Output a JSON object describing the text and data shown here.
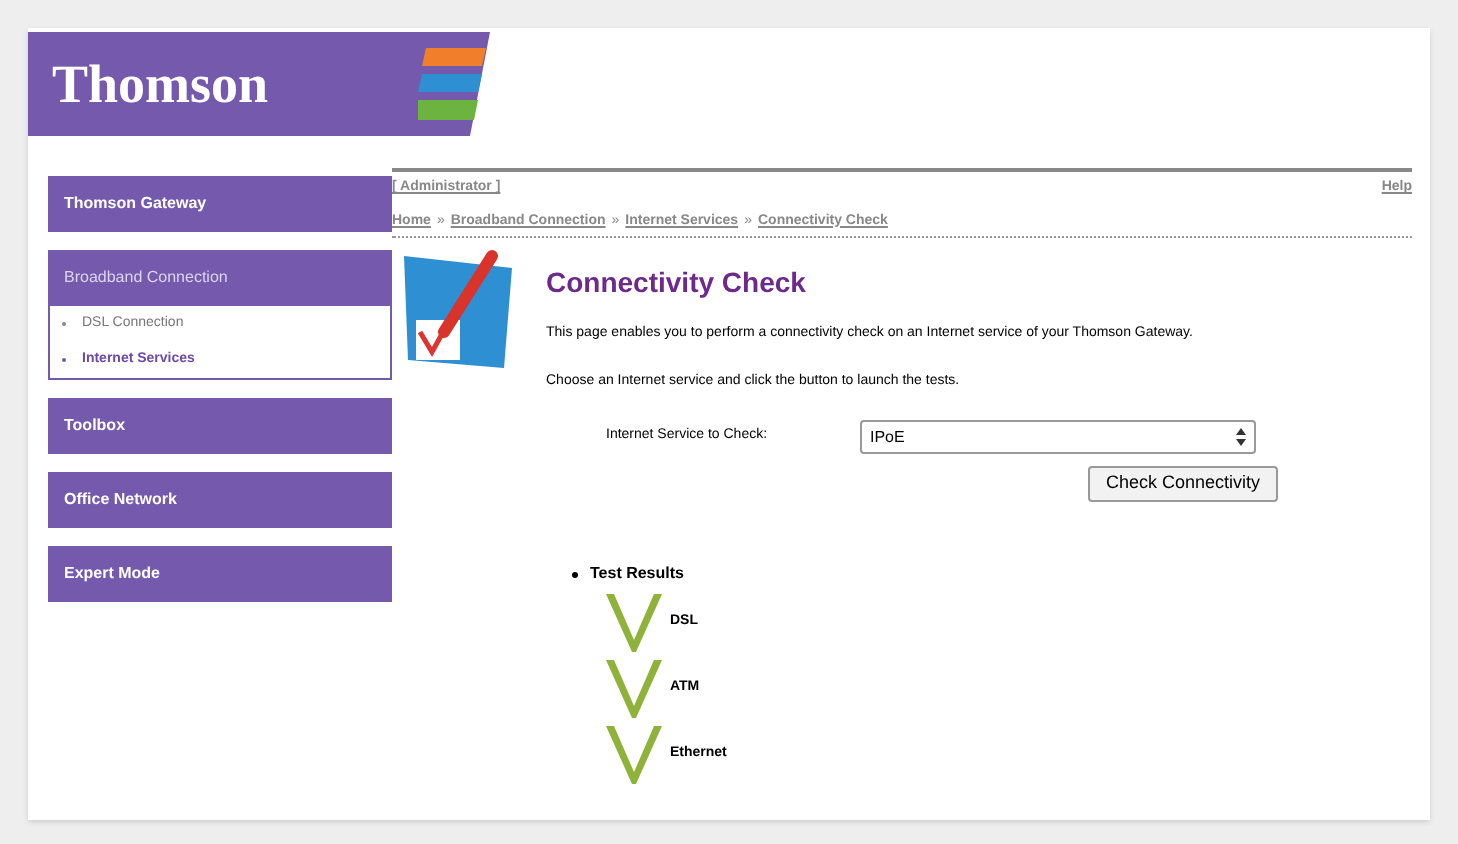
{
  "header": {
    "logo": "Thomson"
  },
  "sidebar": {
    "items": [
      {
        "label": "Thomson Gateway",
        "expanded": false
      },
      {
        "label": "Broadband Connection",
        "expanded": true,
        "children": [
          {
            "label": "DSL Connection",
            "selected": false
          },
          {
            "label": "Internet Services",
            "selected": true
          }
        ]
      },
      {
        "label": "Toolbox",
        "expanded": false
      },
      {
        "label": "Office Network",
        "expanded": false
      },
      {
        "label": "Expert Mode",
        "expanded": false
      }
    ]
  },
  "user": "[ Administrator ]",
  "help": "Help",
  "breadcrumb": [
    "Home",
    "Broadband Connection",
    "Internet Services",
    "Connectivity Check"
  ],
  "breadcrumb_separator": "»",
  "title": "Connectivity Check",
  "paragraphs": [
    "This page enables you to perform a connectivity check on an Internet service of your Thomson Gateway.",
    "Choose an Internet service and click the button to launch the tests."
  ],
  "form": {
    "label": "Internet Service to Check:",
    "value": "IPoE",
    "button": "Check Connectivity"
  },
  "results": {
    "title": "Test Results",
    "items": [
      {
        "label": "DSL",
        "passed": true
      },
      {
        "label": "ATM",
        "passed": true
      },
      {
        "label": "Ethernet",
        "passed": true
      }
    ]
  }
}
